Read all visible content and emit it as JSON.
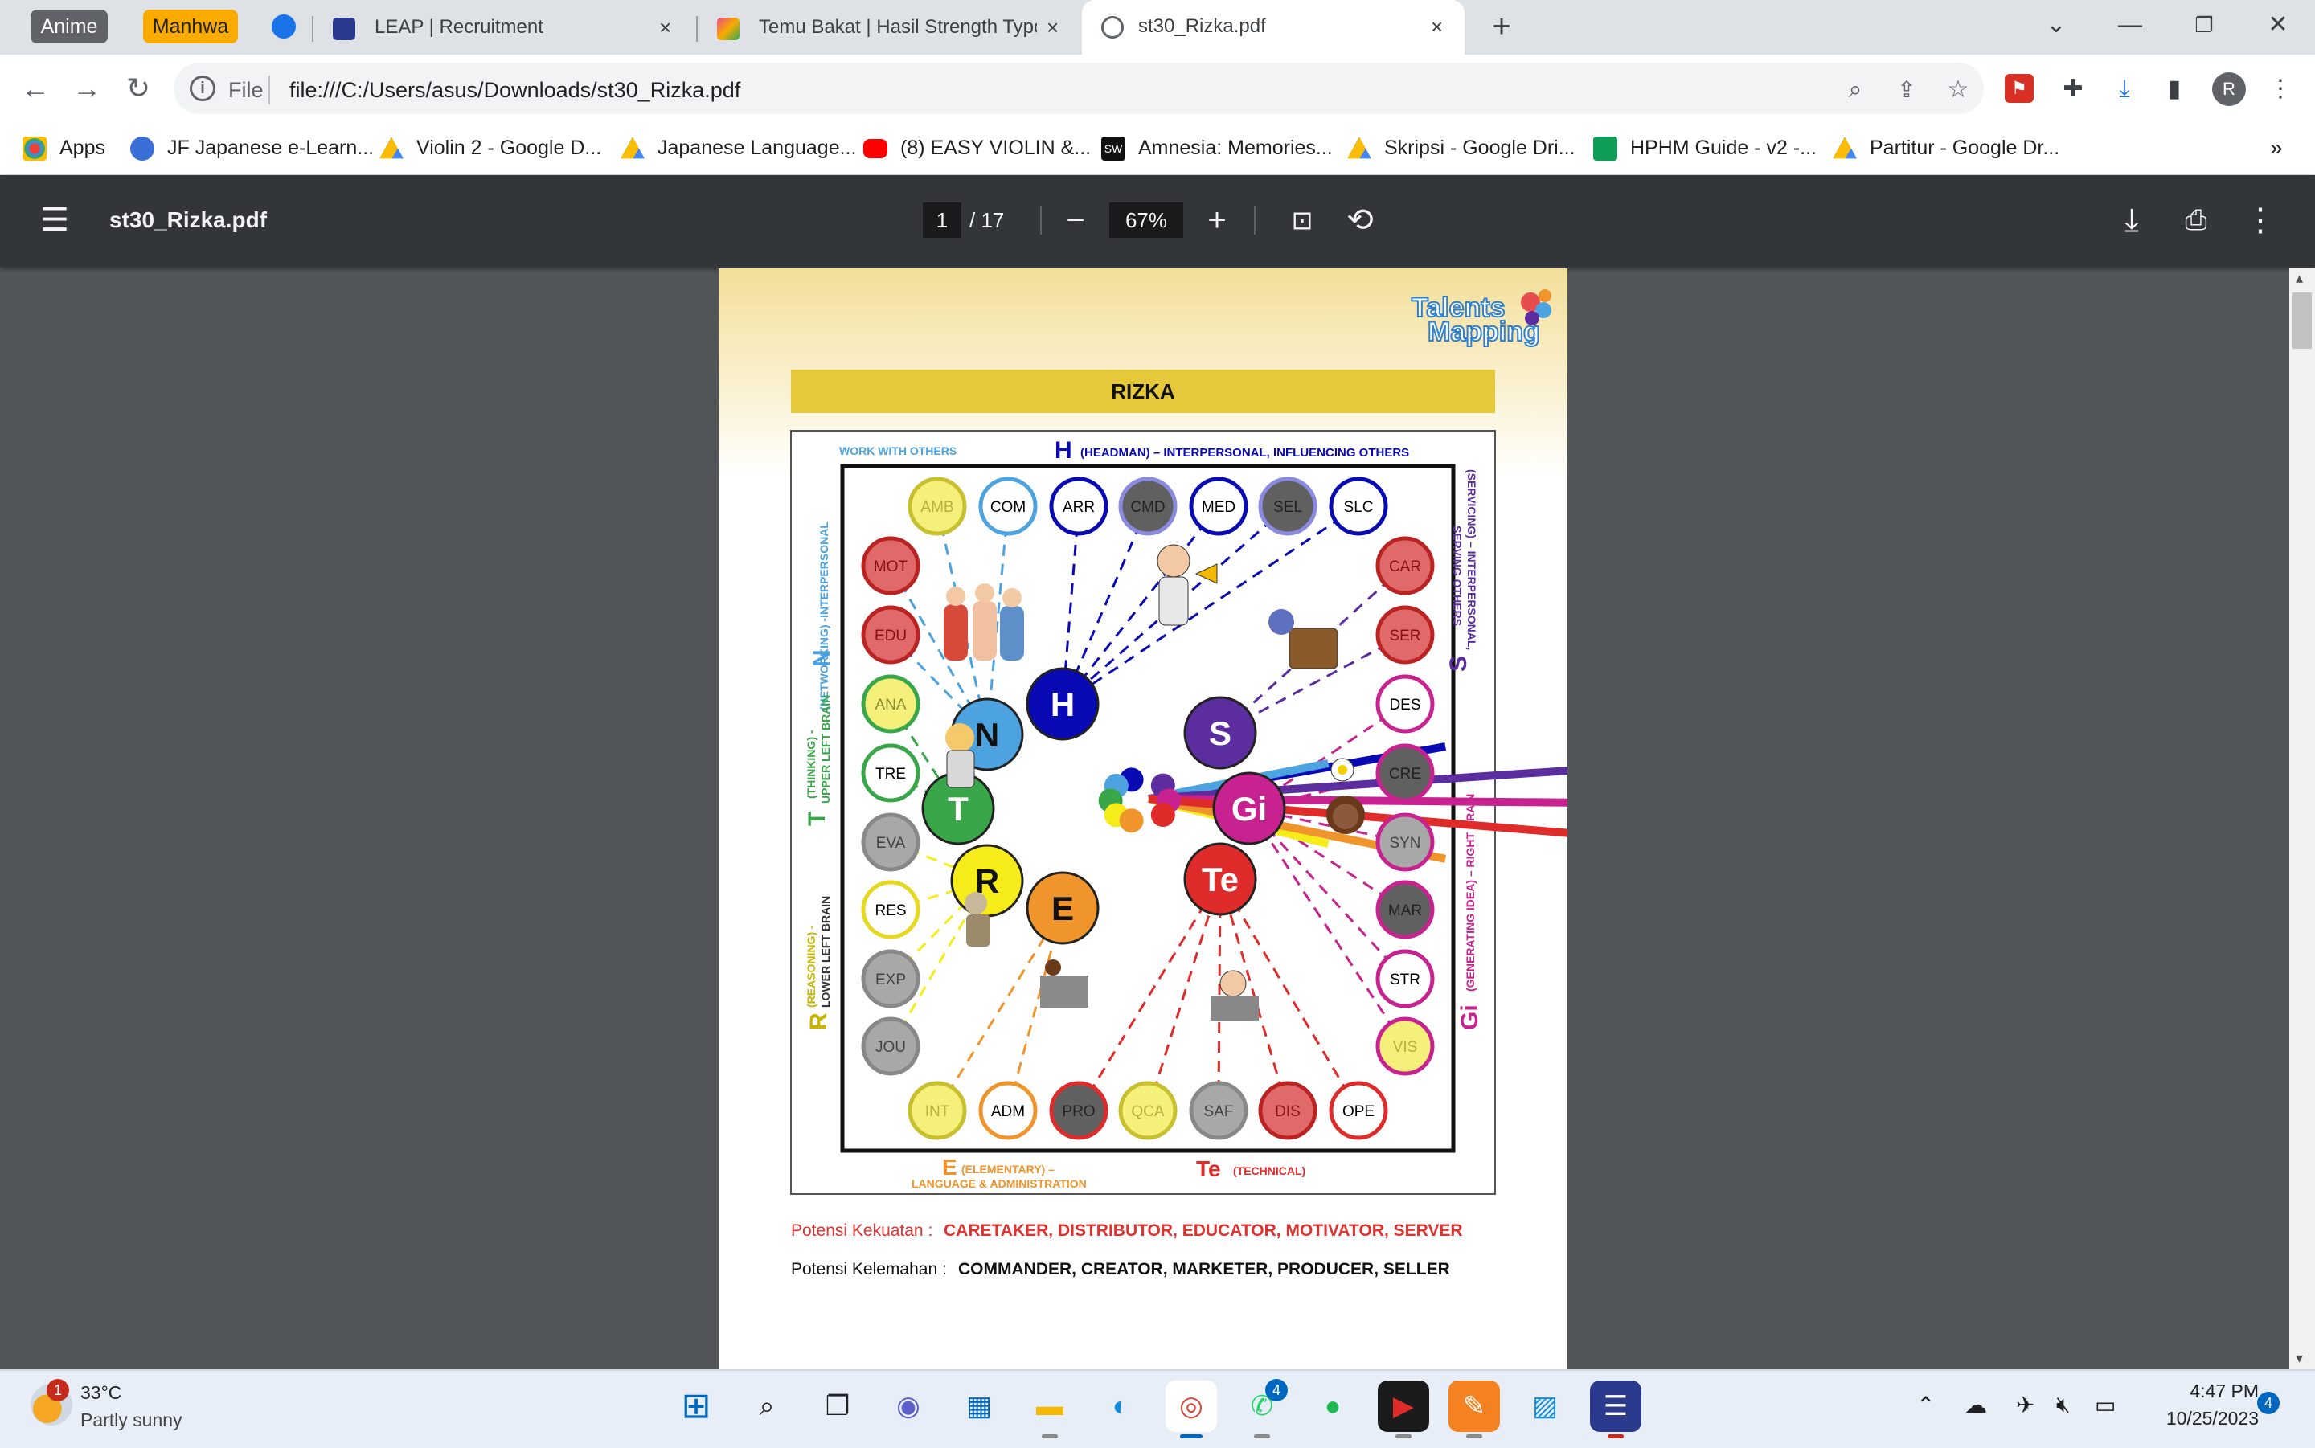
{
  "tabs": {
    "groups": [
      {
        "label": "Anime",
        "color": "#5f6368"
      },
      {
        "label": "Manhwa",
        "color": "#f9ab00"
      }
    ],
    "items": [
      {
        "label": "LEAP | Recruitment",
        "icon": "leap-icon"
      },
      {
        "label": "Temu Bakat | Hasil Strength Typo",
        "icon": "temubakat-icon"
      },
      {
        "label": "st30_Rizka.pdf",
        "icon": "globe-icon"
      }
    ],
    "close": "×",
    "new_tab": "+"
  },
  "address": {
    "scheme": "File",
    "url": "file:///C:/Users/asus/Downloads/st30_Rizka.pdf"
  },
  "bookmarks": [
    {
      "label": "Apps",
      "icon": "apps-grid-icon"
    },
    {
      "label": "JF Japanese e-Learn...",
      "icon": "jf-icon"
    },
    {
      "label": "Violin 2 - Google D...",
      "icon": "drive-icon"
    },
    {
      "label": "Japanese Language...",
      "icon": "drive-icon"
    },
    {
      "label": "(8) EASY VIOLIN &...",
      "icon": "youtube-icon"
    },
    {
      "label": "Amnesia: Memories...",
      "icon": "sw-icon"
    },
    {
      "label": "Skripsi - Google Dri...",
      "icon": "drive-icon"
    },
    {
      "label": "HPHM Guide - v2 -...",
      "icon": "sheets-icon"
    },
    {
      "label": "Partitur - Google Dr...",
      "icon": "drive-icon"
    }
  ],
  "bookmarks_more": "»",
  "pdf": {
    "title": "st30_Rizka.pdf",
    "page_current": "1",
    "page_total": "/ 17",
    "zoom": "67%"
  },
  "doc": {
    "logo_line1": "Talents",
    "logo_line2": "Mapping",
    "name": "RIZKA",
    "top_label_left": "WORK WITH OTHERS",
    "top_label_letter": "H",
    "top_label_text": "(HEADMAN) – INTERPERSONAL, INFLUENCING OTHERS",
    "left_n_letter": "N",
    "left_n_text": "(NETWORKING) -INTERPERSONAL",
    "left_t_letter": "T",
    "left_t_text1": "(THINKING) -",
    "left_t_text2": "UPPER LEFT BRAIN",
    "left_r_letter": "R",
    "left_r_text1": "(REASONING) -",
    "left_r_text2": "LOWER LEFT BRAIN",
    "right_s_letter": "S",
    "right_s_text1": "(SERVICING) – INTERPERSONAL,",
    "right_s_text2": "SERVING OTHERS",
    "right_gi_letter": "Gi",
    "right_gi_text": "(GENERATING IDEA) – RIGHT BRAIN",
    "bottom_e_letter": "E",
    "bottom_e_text1": "(ELEMENTARY) –",
    "bottom_e_text2": "LANGUAGE & ADMINISTRATION",
    "bottom_te_letter": "Te",
    "bottom_te_text": "(TECHNICAL)",
    "strength_label": "Potensi Kekuatan : ",
    "strength_value": "CARETAKER, DISTRIBUTOR, EDUCATOR, MOTIVATOR, SERVER",
    "weakness_label": "Potensi Kelemahan : ",
    "weakness_value": "COMMANDER, CREATOR, MARKETER, PRODUCER, SELLER"
  },
  "hub": [
    {
      "label": "H",
      "color": "#0a0ab4"
    },
    {
      "label": "N",
      "color": "#4da3e0"
    },
    {
      "label": "S",
      "color": "#5b2d9e"
    },
    {
      "label": "T",
      "color": "#3aa64a"
    },
    {
      "label": "Gi",
      "color": "#c7228f"
    },
    {
      "label": "R",
      "color": "#f5ec1a"
    },
    {
      "label": "E",
      "color": "#f0952b"
    },
    {
      "label": "Te",
      "color": "#e02b2b"
    }
  ],
  "typology": [
    {
      "code": "AMB",
      "fill": "#f5f07a",
      "ring": "#c9c030",
      "text": "#b8b040"
    },
    {
      "code": "COM",
      "fill": "#ffffff",
      "ring": "#4da3e0",
      "text": "#000000"
    },
    {
      "code": "ARR",
      "fill": "#ffffff",
      "ring": "#0a0ab4",
      "text": "#000000"
    },
    {
      "code": "CMD",
      "fill": "#606060",
      "ring": "#8a8ae0",
      "text": "#222222"
    },
    {
      "code": "MED",
      "fill": "#ffffff",
      "ring": "#0a0ab4",
      "text": "#000000"
    },
    {
      "code": "SEL",
      "fill": "#606060",
      "ring": "#8a8ae0",
      "text": "#222222"
    },
    {
      "code": "SLC",
      "fill": "#ffffff",
      "ring": "#0a0ab4",
      "text": "#000000"
    },
    {
      "code": "MOT",
      "fill": "#e06a6a",
      "ring": "#b22",
      "text": "#8a1010"
    },
    {
      "code": "EDU",
      "fill": "#e06a6a",
      "ring": "#b22",
      "text": "#8a1010"
    },
    {
      "code": "ANA",
      "fill": "#f5f07a",
      "ring": "#3aa64a",
      "text": "#8a8a30"
    },
    {
      "code": "TRE",
      "fill": "#ffffff",
      "ring": "#3aa64a",
      "text": "#000000"
    },
    {
      "code": "EVA",
      "fill": "#a8a8a8",
      "ring": "#888",
      "text": "#444444"
    },
    {
      "code": "RES",
      "fill": "#ffffff",
      "ring": "#e8d820",
      "text": "#000000"
    },
    {
      "code": "EXP",
      "fill": "#a8a8a8",
      "ring": "#888",
      "text": "#444444"
    },
    {
      "code": "JOU",
      "fill": "#a8a8a8",
      "ring": "#888",
      "text": "#444444"
    },
    {
      "code": "CAR",
      "fill": "#e06a6a",
      "ring": "#b22",
      "text": "#8a1010"
    },
    {
      "code": "SER",
      "fill": "#e06a6a",
      "ring": "#b22",
      "text": "#8a1010"
    },
    {
      "code": "DES",
      "fill": "#ffffff",
      "ring": "#c7228f",
      "text": "#000000"
    },
    {
      "code": "CRE",
      "fill": "#606060",
      "ring": "#c7228f",
      "text": "#222222"
    },
    {
      "code": "SYN",
      "fill": "#a8a8a8",
      "ring": "#c7228f",
      "text": "#444444"
    },
    {
      "code": "MAR",
      "fill": "#606060",
      "ring": "#c7228f",
      "text": "#222222"
    },
    {
      "code": "STR",
      "fill": "#ffffff",
      "ring": "#c7228f",
      "text": "#000000"
    },
    {
      "code": "VIS",
      "fill": "#f5f07a",
      "ring": "#c7228f",
      "text": "#b8b040"
    },
    {
      "code": "INT",
      "fill": "#f5f07a",
      "ring": "#c9c030",
      "text": "#b8b040"
    },
    {
      "code": "ADM",
      "fill": "#ffffff",
      "ring": "#f0952b",
      "text": "#000000"
    },
    {
      "code": "PRO",
      "fill": "#606060",
      "ring": "#e02b2b",
      "text": "#222222"
    },
    {
      "code": "QCA",
      "fill": "#f5f07a",
      "ring": "#c9c030",
      "text": "#b8b040"
    },
    {
      "code": "SAF",
      "fill": "#a8a8a8",
      "ring": "#888",
      "text": "#444444"
    },
    {
      "code": "DIS",
      "fill": "#e06a6a",
      "ring": "#b22",
      "text": "#8a1010"
    },
    {
      "code": "OPE",
      "fill": "#ffffff",
      "ring": "#e02b2b",
      "text": "#000000"
    }
  ],
  "taskbar": {
    "weather_temp": "33°C",
    "weather_desc": "Partly sunny",
    "weather_badge": "1",
    "whatsapp_badge": "4",
    "time": "4:47 PM",
    "date": "10/25/2023",
    "notif_count": "4"
  }
}
